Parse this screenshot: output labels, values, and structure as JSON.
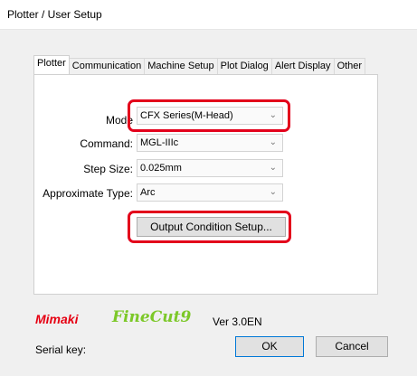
{
  "window": {
    "title": "Plotter / User Setup"
  },
  "tabs": [
    {
      "label": "Plotter"
    },
    {
      "label": "Communication"
    },
    {
      "label": "Machine Setup"
    },
    {
      "label": "Plot Dialog"
    },
    {
      "label": "Alert Display"
    },
    {
      "label": "Other"
    }
  ],
  "plotter": {
    "mode_label": "Mode",
    "mode_value": "CFX Series(M-Head)",
    "command_label": "Command:",
    "command_value": "MGL-IIIc",
    "step_label": "Step Size:",
    "step_value": "0.025mm",
    "approx_label": "Approximate Type:",
    "approx_value": "Arc",
    "output_button": "Output Condition Setup..."
  },
  "footer": {
    "brand": "Mimaki",
    "product": "FineCut9",
    "version": "Ver 3.0EN",
    "serial_label": "Serial key:",
    "ok_label": "OK",
    "cancel_label": "Cancel"
  },
  "colors": {
    "highlight": "#e3001b",
    "brand_red": "#e60012",
    "brand_green": "#7cc828"
  }
}
